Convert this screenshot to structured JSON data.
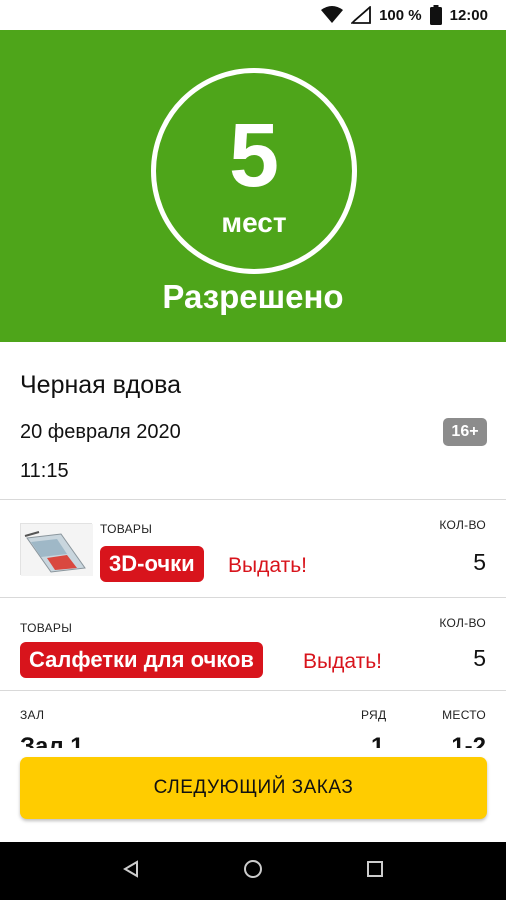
{
  "status_bar": {
    "battery": "100 %",
    "time": "12:00"
  },
  "hero": {
    "count": "5",
    "unit": "мест",
    "status": "Разрешено",
    "color": "#4ea51a"
  },
  "film": {
    "title": "Черная вдова",
    "date": "20 февраля 2020",
    "time": "11:15",
    "age_rating": "16+"
  },
  "items": [
    {
      "label": "ТОВАРЫ",
      "name": "3D-очки",
      "action": "Выдать!",
      "qty_label": "КОЛ-ВО",
      "qty": "5"
    },
    {
      "label": "ТОВАРЫ",
      "name": "Салфетки для очков",
      "action": "Выдать!",
      "qty_label": "КОЛ-ВО",
      "qty": "5"
    }
  ],
  "seat": {
    "hall_label": "ЗАЛ",
    "hall_value": "Зал 1",
    "row_label": "РЯД",
    "row_value": "1",
    "place_label": "МЕСТО",
    "place_value": "1-2"
  },
  "buttons": {
    "next_order": "СЛЕДУЮЩИЙ ЗАКАЗ"
  },
  "colors": {
    "accent_red": "#d8141c",
    "button_yellow": "#ffcc00"
  }
}
